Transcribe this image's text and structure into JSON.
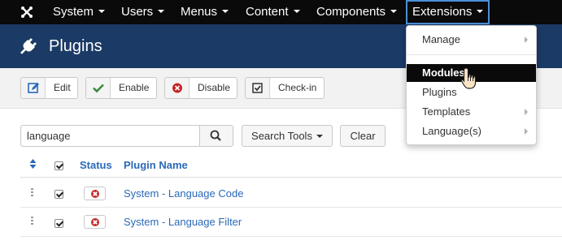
{
  "navbar": {
    "items": [
      {
        "label": "System"
      },
      {
        "label": "Users"
      },
      {
        "label": "Menus"
      },
      {
        "label": "Content"
      },
      {
        "label": "Components"
      },
      {
        "label": "Extensions"
      }
    ],
    "active_item": "Extensions",
    "logo_icon": "joomla-logo-icon"
  },
  "page": {
    "title": "Plugins",
    "title_icon": "plug-icon"
  },
  "toolbar": {
    "buttons": [
      {
        "label": "Edit",
        "icon": "edit-icon",
        "icon_color": "#2a69b8"
      },
      {
        "label": "Enable",
        "icon": "check-icon",
        "icon_color": "#3c8a3c"
      },
      {
        "label": "Disable",
        "icon": "disable-icon",
        "icon_color": "#c52827"
      },
      {
        "label": "Check-in",
        "icon": "checkbox-icon",
        "icon_color": "#333333"
      }
    ]
  },
  "search": {
    "value": "language",
    "tools_label": "Search Tools",
    "clear_label": "Clear"
  },
  "table": {
    "headers": {
      "status": "Status",
      "plugin_name": "Plugin Name"
    },
    "rows": [
      {
        "checked": true,
        "status": "disabled",
        "name": "System - Language Code"
      },
      {
        "checked": true,
        "status": "disabled",
        "name": "System - Language Filter"
      }
    ]
  },
  "extensions_menu": {
    "items": [
      {
        "label": "Manage",
        "submenu": true
      },
      {
        "label": "Modules",
        "submenu": false,
        "highlighted": true
      },
      {
        "label": "Plugins",
        "submenu": false
      },
      {
        "label": "Templates",
        "submenu": true
      },
      {
        "label": "Language(s)",
        "submenu": true
      }
    ]
  },
  "colors": {
    "navbar_bg": "#0a0a0a",
    "titlebar_bg": "#1b3a66",
    "link": "#2a69b8",
    "active_outline": "#4a90d9",
    "status_red": "#c52827"
  }
}
